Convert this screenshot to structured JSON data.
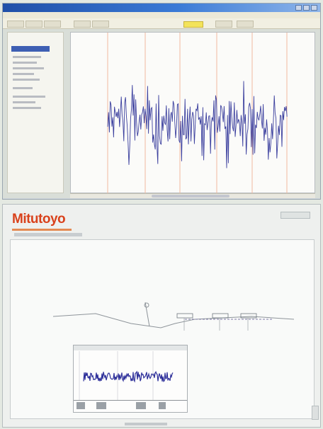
{
  "top_window": {
    "title": "",
    "menu": [
      "",
      "",
      "",
      "",
      "",
      ""
    ],
    "colors": {
      "titlebar": "#2a5fb8",
      "waveform": "#3b3f9e",
      "gridline_vertical": "#f2b8a0",
      "sidebar_selected": "#3e5fb3",
      "toolbar_highlight": "#f3e35a"
    },
    "icons": [
      "minimize-icon",
      "maximize-icon",
      "close-icon"
    ]
  },
  "report_window": {
    "logo_text": "Mitutoyo",
    "colors": {
      "logo": "#d9421c",
      "waveform": "#2d2f9a",
      "profile_line": "#8e949a"
    }
  }
}
